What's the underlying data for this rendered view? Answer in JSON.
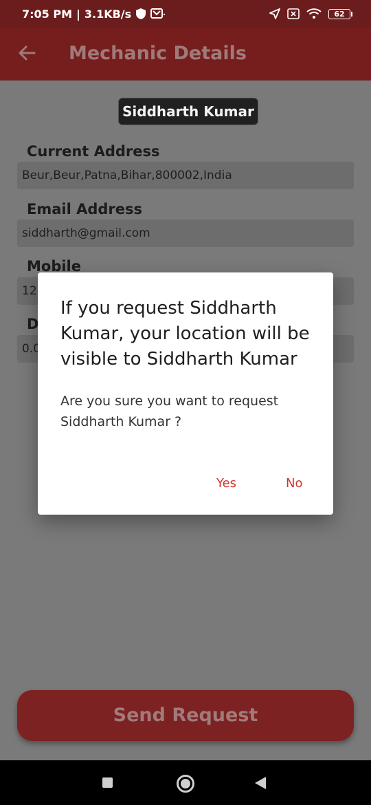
{
  "status_bar": {
    "time": "7:05 PM",
    "net_speed": "3.1KB/s",
    "battery": "62",
    "icons": [
      "shield-icon",
      "mail-icon",
      "location-arrow-icon",
      "sim-off-icon",
      "wifi-icon",
      "battery-icon"
    ]
  },
  "app_bar": {
    "title": "Mechanic Details",
    "back_icon": "arrow-left-icon"
  },
  "mechanic": {
    "name": "Siddharth Kumar"
  },
  "fields": {
    "address_label": "Current Address",
    "address_value": "Beur,Beur,Patna,Bihar,800002,India",
    "email_label": "Email Address",
    "email_value": "siddharth@gmail.com",
    "mobile_label": "Mobile",
    "mobile_value_visible": "12",
    "distance_label_visible": "D",
    "distance_value_visible": "0.0"
  },
  "dialog": {
    "title": "If you request Siddharth Kumar, your location will be visible to Siddharth Kumar",
    "message": "Are you sure you want to request Siddharth Kumar ?",
    "yes_label": "Yes",
    "no_label": "No"
  },
  "send_button": {
    "label": "Send Request"
  },
  "colors": {
    "app_bar": "#761e1e",
    "status_bar": "#6b1d1d",
    "accent": "#d0342c",
    "send_button": "#7c2222"
  }
}
